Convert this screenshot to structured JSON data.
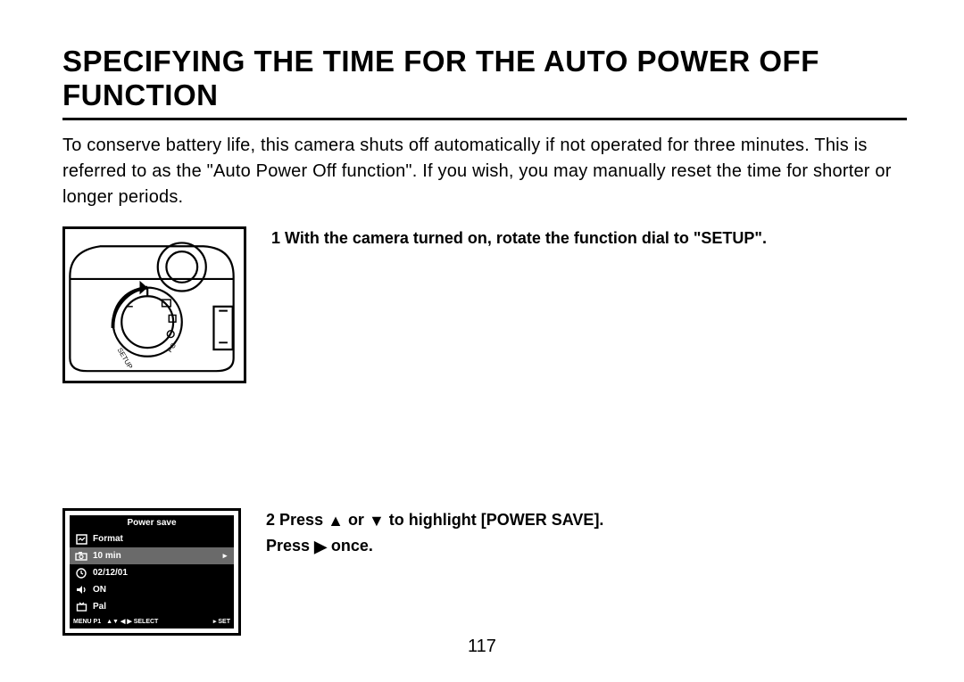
{
  "title": "SPECIFYING THE TIME FOR THE AUTO POWER OFF FUNCTION",
  "intro": "To conserve battery life, this camera shuts off automatically if not operated for three minutes. This is referred to as the \"Auto Power Off function\". If you wish, you may manually reset the time for shorter or longer periods.",
  "steps": {
    "s1": {
      "num": "1",
      "text_a": "With the camera turned on, rotate the function dial to \"SETUP\"."
    },
    "s2": {
      "num": "2",
      "text_a": "Press",
      "text_b": "or",
      "text_c": "to highlight [POWER SAVE].",
      "text_d": "Press",
      "text_e": "once."
    }
  },
  "lcd": {
    "header": "Power save",
    "rows": [
      {
        "icon": "format-icon",
        "label": "Format"
      },
      {
        "icon": "camera-icon",
        "label": "10 min",
        "selected": true,
        "arrow": true
      },
      {
        "icon": "clock-icon",
        "label": "02/12/01"
      },
      {
        "icon": "speaker-icon",
        "label": "ON"
      },
      {
        "icon": "tv-icon",
        "label": "Pal"
      }
    ],
    "footer": {
      "menu": "MENU P1",
      "select": "SELECT",
      "set": "SET"
    }
  },
  "triangles": {
    "up": "▲",
    "down": "▼",
    "left": "◀",
    "right": "▶",
    "right_small": "▸"
  },
  "page_number": "117"
}
